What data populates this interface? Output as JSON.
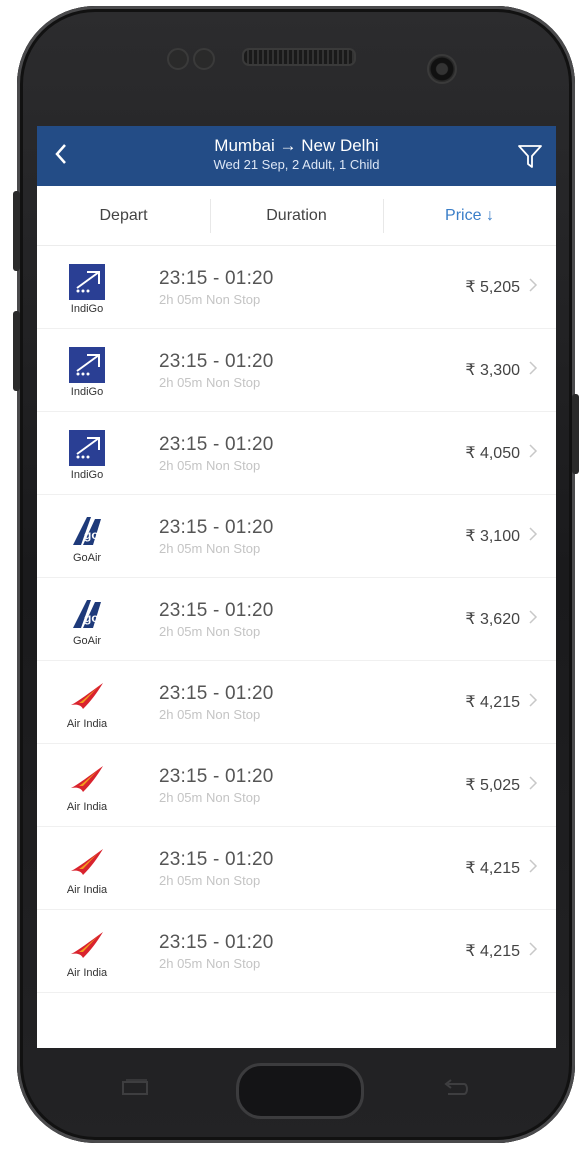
{
  "header": {
    "route": "Mumbai → New Delhi",
    "details": "Wed 21 Sep, 2 Adult, 1 Child",
    "back_icon": "chevron-left-icon",
    "filter_icon": "filter-funnel-icon"
  },
  "sort": {
    "depart": "Depart",
    "duration": "Duration",
    "price": "Price ↓",
    "active": "price"
  },
  "colors": {
    "header_bg": "#234c86",
    "accent": "#3a7ec8",
    "indigo": "#2a3f94",
    "goair": "#1e3a7a",
    "airindia_red": "#d9232e",
    "airindia_orange": "#f39a1e"
  },
  "flights": [
    {
      "airline": "IndiGo",
      "time": "23:15  -  01:20",
      "meta": "2h 05m  Non Stop",
      "price": "₹ 5,205"
    },
    {
      "airline": "IndiGo",
      "time": "23:15  -  01:20",
      "meta": "2h 05m  Non Stop",
      "price": "₹ 3,300"
    },
    {
      "airline": "IndiGo",
      "time": "23:15  -  01:20",
      "meta": "2h 05m  Non Stop",
      "price": "₹ 4,050"
    },
    {
      "airline": "GoAir",
      "time": "23:15  -  01:20",
      "meta": "2h 05m  Non Stop",
      "price": "₹ 3,100"
    },
    {
      "airline": "GoAir",
      "time": "23:15  -  01:20",
      "meta": "2h 05m  Non Stop",
      "price": "₹ 3,620"
    },
    {
      "airline": "Air India",
      "time": "23:15  -  01:20",
      "meta": "2h 05m  Non Stop",
      "price": "₹ 4,215"
    },
    {
      "airline": "Air India",
      "time": "23:15  -  01:20",
      "meta": "2h 05m  Non Stop",
      "price": "₹ 5,025"
    },
    {
      "airline": "Air India",
      "time": "23:15  -  01:20",
      "meta": "2h 05m  Non Stop",
      "price": "₹ 4,215"
    },
    {
      "airline": "Air India",
      "time": "23:15  -  01:20",
      "meta": "2h 05m  Non Stop",
      "price": "₹ 4,215"
    }
  ]
}
